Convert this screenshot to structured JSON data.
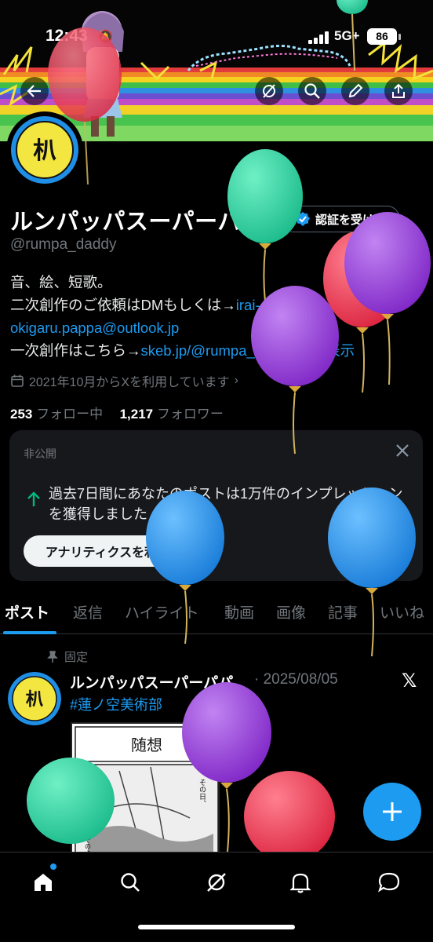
{
  "status_bar": {
    "time": "12:43",
    "network": "5G+",
    "battery": "86"
  },
  "profile": {
    "name": "ルンパッパスーパーパパ",
    "handle": "@rumpa_daddy",
    "verify_button": "認証を受ける",
    "bio": {
      "line1": "音、絵、短歌。",
      "line2_text": "二次創作のご依頼はDMもしくは→",
      "line2_link": "irai-",
      "line3_link": "okigaru.pappa@outlook.jp",
      "line4_text": "一次創作はこちら→",
      "line4_link": "skeb.jp/@rumpa_d...",
      "more": "さらに表示"
    },
    "joined": "2021年10月からXを利用しています",
    "following_count": "253",
    "following_label": "フォロー中",
    "followers_count": "1,217",
    "followers_label": "フォロワー"
  },
  "private_card": {
    "label": "非公開",
    "text": "過去7日間にあなたのポストは1万件のインプレッションを獲得しました",
    "button": "アナリティクスを利用する"
  },
  "tabs": [
    "ポスト",
    "返信",
    "ハイライト",
    "動画",
    "画像",
    "記事",
    "いいね"
  ],
  "post": {
    "pinned_label": "固定",
    "author": "ルンパッパスーパーパパ",
    "date": "· 2025/08/05",
    "hashtag": "#蓮ノ空美術部",
    "image_text": {
      "title": "随想",
      "left": "雨が大きな魚が、そのように増えた。",
      "right": "その日、"
    }
  },
  "colors": {
    "accent": "#1d9bf0",
    "background": "#000000",
    "secondary_text": "#71767b",
    "positive": "#00ba7c"
  },
  "icons": {
    "header": [
      "back-icon",
      "grok-icon",
      "search-icon",
      "edit-icon",
      "share-icon"
    ],
    "bottom_nav": [
      "home-icon",
      "search-icon",
      "grok-icon",
      "notifications-icon",
      "messages-icon"
    ]
  }
}
